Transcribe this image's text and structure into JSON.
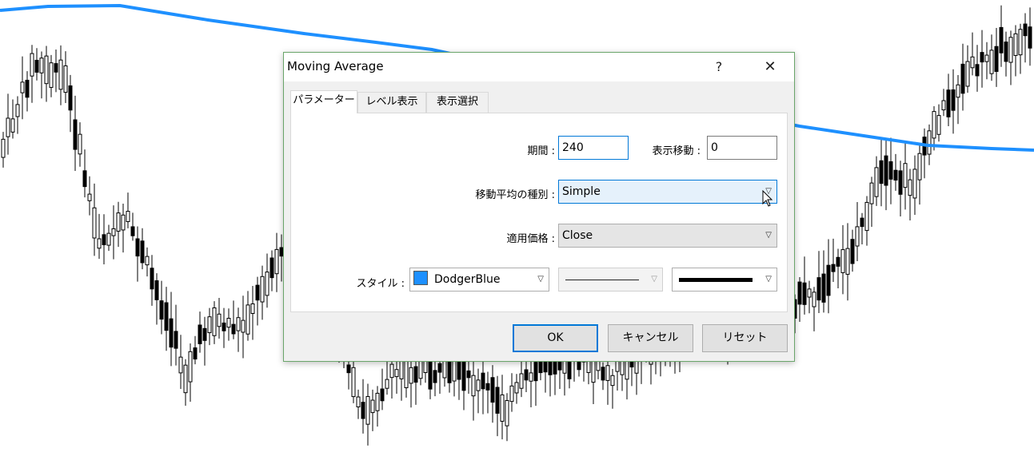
{
  "dialog": {
    "title": "Moving Average",
    "help_label": "?",
    "close_label": "✕"
  },
  "tabs": [
    {
      "label": "パラメーター",
      "active": true
    },
    {
      "label": "レベル表示",
      "active": false
    },
    {
      "label": "表示選択",
      "active": false
    }
  ],
  "params": {
    "period_label": "期間 :",
    "period_value": "240",
    "shift_label": "表示移動 :",
    "shift_value": "0",
    "method_label": "移動平均の種別 :",
    "method_value": "Simple",
    "price_label": "適用価格 :",
    "price_value": "Close",
    "style_label": "スタイル :",
    "color_value": "DodgerBlue",
    "color_hex": "#1e90ff"
  },
  "buttons": {
    "ok": "OK",
    "cancel": "キャンセル",
    "reset": "リセット"
  }
}
